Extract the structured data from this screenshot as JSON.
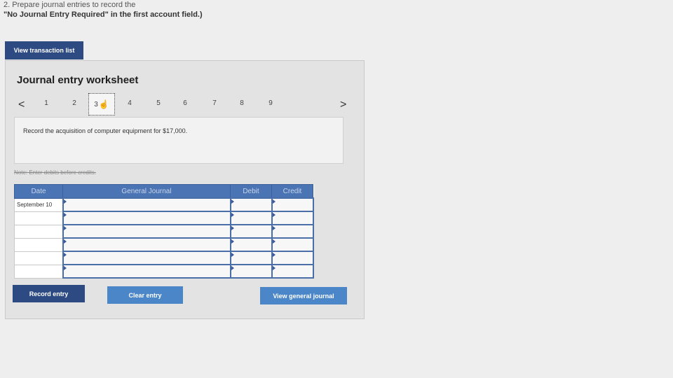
{
  "instructions": {
    "line1": "2. Prepare journal entries to record the",
    "line2": "\"No Journal Entry Required\" in the first account field.)"
  },
  "view_transaction_list_label": "View transaction list",
  "worksheet": {
    "title": "Journal entry worksheet",
    "prev_arrow": "<",
    "next_arrow": ">",
    "tabs": [
      "1",
      "2",
      "3",
      "4",
      "5",
      "6",
      "7",
      "8",
      "9"
    ],
    "active_tab": "3",
    "description": "Record the acquisition of computer equipment for $17,000.",
    "note": "Note: Enter debits before credits."
  },
  "journal_table": {
    "headers": {
      "date": "Date",
      "general_journal": "General Journal",
      "debit": "Debit",
      "credit": "Credit"
    },
    "rows": [
      {
        "date": "September 10"
      },
      {
        "date": ""
      },
      {
        "date": ""
      },
      {
        "date": ""
      },
      {
        "date": ""
      },
      {
        "date": ""
      }
    ]
  },
  "buttons": {
    "record_entry": "Record entry",
    "clear_entry": "Clear entry",
    "view_general_journal": "View general journal"
  },
  "colors": {
    "dark_button": "#2e4a82",
    "light_button": "#4a86c8",
    "table_header": "#4a74b4"
  },
  "icons": {
    "cursor": "hand-pointer-icon"
  }
}
